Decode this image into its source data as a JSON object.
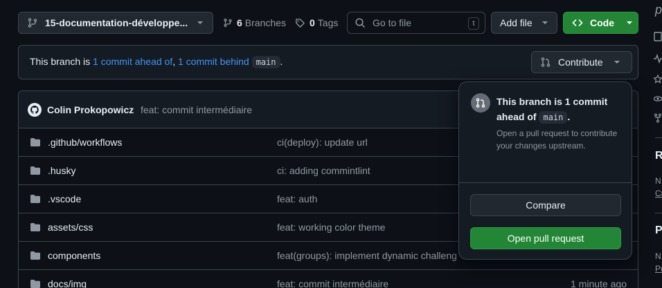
{
  "toolbar": {
    "branch_name": "15-documentation-développe...",
    "branches_count": "6",
    "branches_label": "Branches",
    "tags_count": "0",
    "tags_label": "Tags",
    "search_placeholder": "Go to file",
    "search_shortcut": "t",
    "add_file_label": "Add file",
    "code_label": "Code"
  },
  "banner": {
    "prefix": "This branch is ",
    "ahead_link": "1 commit ahead of",
    "comma": ", ",
    "behind_link": "1 commit behind",
    "base_branch": "main",
    "suffix": ".",
    "contribute_label": "Contribute"
  },
  "latest_commit": {
    "author": "Colin Prokopowicz",
    "message": "feat: commit intermédiaire"
  },
  "files": [
    {
      "name": ".github/workflows",
      "message": "ci(deploy): update url",
      "age": ""
    },
    {
      "name": ".husky",
      "message": "ci: adding commintlint",
      "age": ""
    },
    {
      "name": ".vscode",
      "message": "feat: auth",
      "age": ""
    },
    {
      "name": "assets/css",
      "message": "feat: working color theme",
      "age": ""
    },
    {
      "name": "components",
      "message": "feat(groups): implement dynamic challeng",
      "age": ""
    },
    {
      "name": "docs/img",
      "message": "feat: commit intermédiaire",
      "age": "1 minute ago"
    }
  ],
  "popover": {
    "title_prefix": "This branch is 1 commit ahead of ",
    "title_branch": "main",
    "title_suffix": ".",
    "description": "Open a pull request to contribute your changes upstream.",
    "compare_label": "Compare",
    "open_pr_label": "Open pull request"
  },
  "sidebar_cutoff": {
    "top": "p",
    "r_heading": "R",
    "r_line1": "N",
    "r_link": "Cr",
    "p_heading": "P",
    "p_line1": "N",
    "p_link": "Pu"
  },
  "colors": {
    "background": "#0d1117",
    "accent_green": "#238636",
    "link_blue": "#4493f8",
    "border": "#3d444d"
  }
}
